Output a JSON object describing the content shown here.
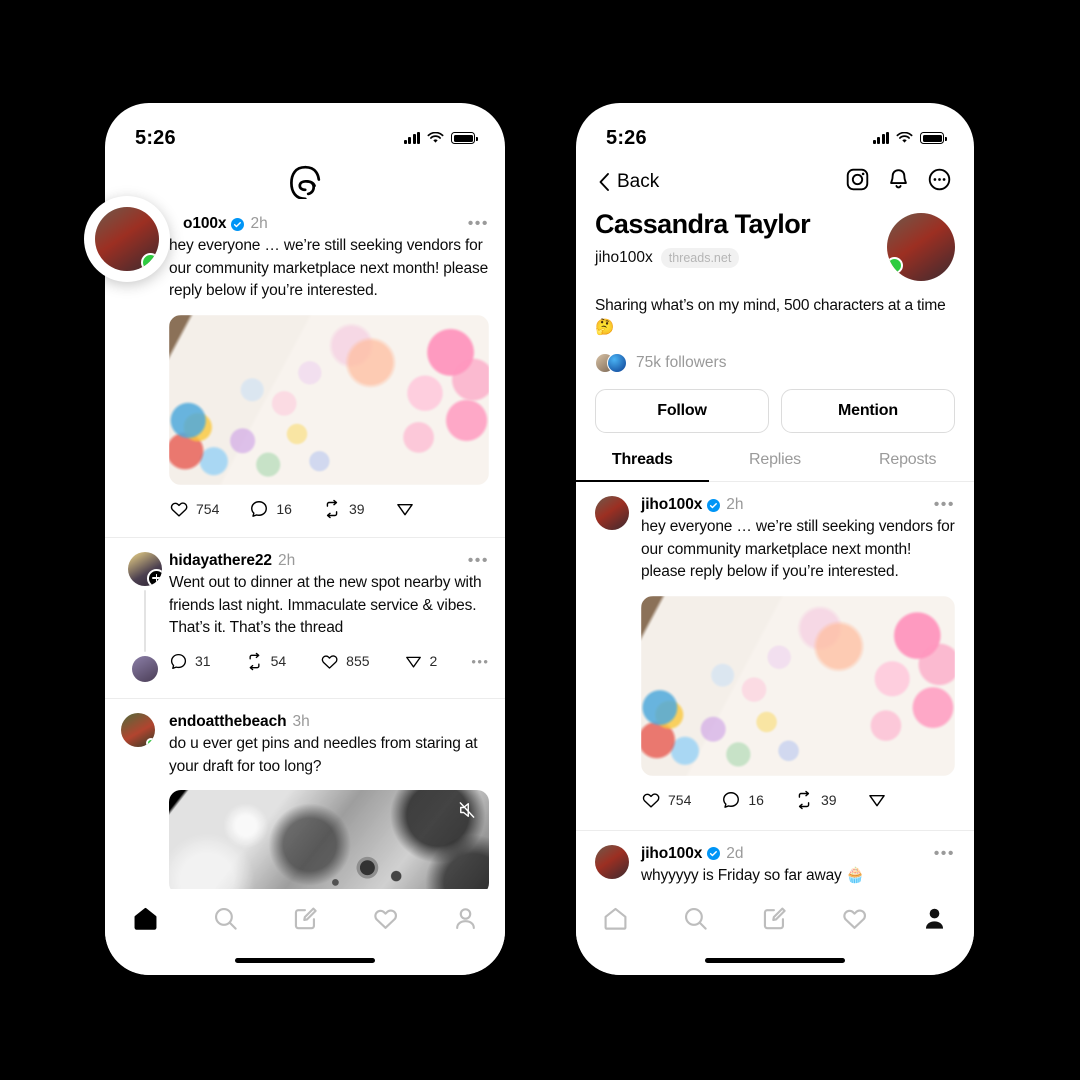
{
  "app": {
    "name": "Threads",
    "logo_icon": "threads-logo-icon"
  },
  "colors": {
    "accent": "#0095f6",
    "online": "#2ecc40",
    "text": "#0b0b0b",
    "muted": "#999999",
    "background": "#000000",
    "surface": "#ffffff"
  },
  "left_phone": {
    "status": {
      "time": "5:26",
      "signal_icon": "cellular-signal-icon",
      "wifi_icon": "wifi-icon",
      "battery_icon": "battery-icon"
    },
    "floating_avatar": {
      "name": "jiho100x",
      "online": true
    },
    "posts": [
      {
        "username": "jiho100x",
        "username_truncated": "o100x",
        "verified": true,
        "time": "2h",
        "text": "hey everyone … we’re still seeking vendors for our community marketplace next month! please reply below if you’re interested.",
        "media": "stickers-photo",
        "actions": [
          {
            "icon": "heart-icon",
            "count": "754"
          },
          {
            "icon": "comment-icon",
            "count": "16"
          },
          {
            "icon": "repost-icon",
            "count": "39"
          },
          {
            "icon": "share-icon",
            "count": ""
          }
        ],
        "more_icon": "more-options-icon"
      },
      {
        "username": "hidayathere22",
        "verified": false,
        "time": "2h",
        "text": "Went out to dinner at the new spot nearby with friends last night. Immaculate service & vibes. That’s it. That’s the thread",
        "has_plus_badge": true,
        "actions": [
          {
            "icon": "comment-icon",
            "count": "31"
          },
          {
            "icon": "repost-icon",
            "count": "54"
          },
          {
            "icon": "heart-icon",
            "count": "855"
          },
          {
            "icon": "share-icon",
            "count": "2"
          }
        ],
        "more_icon": "more-options-icon"
      },
      {
        "username": "endoatthebeach",
        "verified": false,
        "time": "3h",
        "text": "do u ever get pins and needles from staring at your draft for too long?",
        "media": "moon-video",
        "media_badge_icon": "muted-speaker-icon",
        "online": true
      }
    ],
    "tabbar": [
      {
        "icon": "home-icon",
        "active": true
      },
      {
        "icon": "search-icon",
        "active": false
      },
      {
        "icon": "compose-icon",
        "active": false
      },
      {
        "icon": "heart-icon",
        "active": false
      },
      {
        "icon": "profile-icon",
        "active": false
      }
    ]
  },
  "right_phone": {
    "status": {
      "time": "5:26",
      "signal_icon": "cellular-signal-icon",
      "wifi_icon": "wifi-icon",
      "battery_icon": "battery-icon"
    },
    "nav": {
      "back_label": "Back",
      "back_icon": "chevron-left-icon",
      "icons": [
        {
          "name": "instagram-icon"
        },
        {
          "name": "bell-icon"
        },
        {
          "name": "more-circle-icon"
        }
      ]
    },
    "profile": {
      "display_name": "Cassandra Taylor",
      "handle": "jiho100x",
      "domain_pill": "threads.net",
      "bio": "Sharing what’s on my mind, 500 characters at a time 🤔",
      "followers": "75k followers",
      "online": true
    },
    "buttons": [
      {
        "label": "Follow"
      },
      {
        "label": "Mention"
      }
    ],
    "tabs": [
      {
        "label": "Threads",
        "active": true
      },
      {
        "label": "Replies",
        "active": false
      },
      {
        "label": "Reposts",
        "active": false
      }
    ],
    "posts": [
      {
        "username": "jiho100x",
        "verified": true,
        "time": "2h",
        "text": "hey everyone … we’re still seeking vendors for our community marketplace next month! please reply below if you’re interested.",
        "media": "stickers-photo",
        "actions": [
          {
            "icon": "heart-icon",
            "count": "754"
          },
          {
            "icon": "comment-icon",
            "count": "16"
          },
          {
            "icon": "repost-icon",
            "count": "39"
          },
          {
            "icon": "share-icon",
            "count": ""
          }
        ],
        "more_icon": "more-options-icon"
      },
      {
        "username": "jiho100x",
        "verified": true,
        "time": "2d",
        "text": "whyyyyy is Friday so far away 🧁",
        "more_icon": "more-options-icon"
      }
    ],
    "tabbar": [
      {
        "icon": "home-icon",
        "active": false
      },
      {
        "icon": "search-icon",
        "active": false
      },
      {
        "icon": "compose-icon",
        "active": false
      },
      {
        "icon": "heart-icon",
        "active": false
      },
      {
        "icon": "profile-icon",
        "active": true
      }
    ]
  }
}
